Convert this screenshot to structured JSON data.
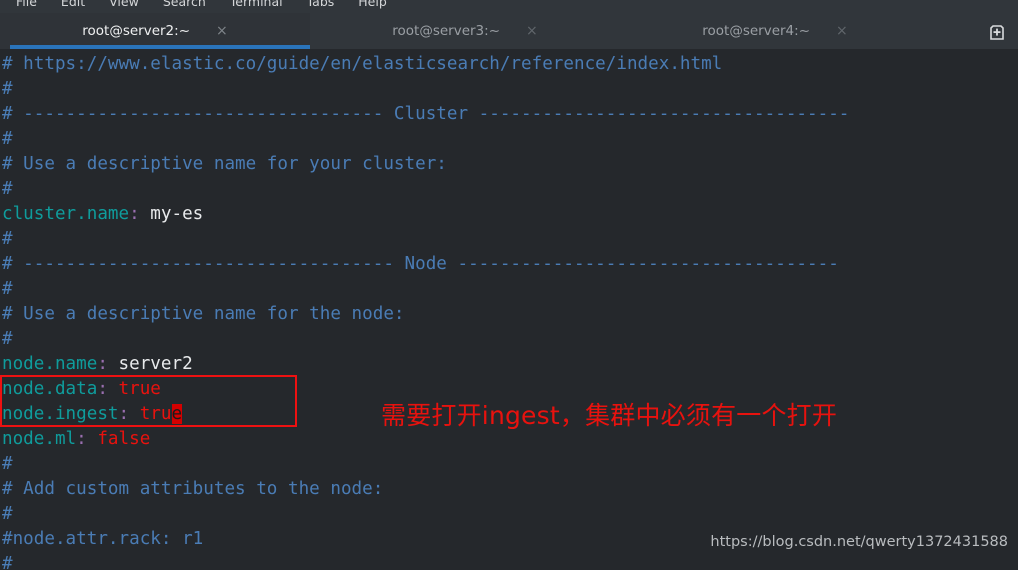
{
  "window": {
    "menu": [
      "File",
      "Edit",
      "View",
      "Search",
      "Terminal",
      "Tabs",
      "Help"
    ]
  },
  "tabs": {
    "items": [
      {
        "label": "root@server2:~",
        "close": "×",
        "active": true
      },
      {
        "label": "root@server3:~",
        "close": "×",
        "active": false
      },
      {
        "label": "root@server4:~",
        "close": "×",
        "active": false
      }
    ],
    "new_tab_label": "new-tab"
  },
  "terminal": {
    "lines": [
      {
        "type": "comment",
        "text": "# https://www.elastic.co/guide/en/elasticsearch/reference/index.html"
      },
      {
        "type": "comment",
        "text": "#"
      },
      {
        "type": "comment",
        "text": "# ---------------------------------- Cluster -----------------------------------"
      },
      {
        "type": "comment",
        "text": "#"
      },
      {
        "type": "comment",
        "text": "# Use a descriptive name for your cluster:"
      },
      {
        "type": "comment",
        "text": "#"
      },
      {
        "type": "setting",
        "key": "cluster.name",
        "colon": ":",
        "value": " my-es",
        "value_kind": "string"
      },
      {
        "type": "comment",
        "text": "#"
      },
      {
        "type": "comment",
        "text": "# ----------------------------------- Node ------------------------------------"
      },
      {
        "type": "comment",
        "text": "#"
      },
      {
        "type": "comment",
        "text": "# Use a descriptive name for the node:"
      },
      {
        "type": "comment",
        "text": "#"
      },
      {
        "type": "setting",
        "key": "node.name",
        "colon": ":",
        "value": " server2",
        "value_kind": "string"
      },
      {
        "type": "setting",
        "key": "node.data",
        "colon": ":",
        "value": " true",
        "value_kind": "bool"
      },
      {
        "type": "setting",
        "key": "node.ingest",
        "colon": ":",
        "value": " tru",
        "value_kind": "bool",
        "cursor_char": "e"
      },
      {
        "type": "setting",
        "key": "node.ml",
        "colon": ":",
        "value": " false",
        "value_kind": "bool"
      },
      {
        "type": "comment",
        "text": "#"
      },
      {
        "type": "comment",
        "text": "# Add custom attributes to the node:"
      },
      {
        "type": "comment",
        "text": "#"
      },
      {
        "type": "comment",
        "text": "#node.attr.rack: r1"
      },
      {
        "type": "comment",
        "text": "#"
      }
    ]
  },
  "annotations": {
    "note_text": "需要打开ingest，集群中必须有一个打开",
    "note_color": "#e8120e",
    "box_color": "#ee1111"
  },
  "watermark": {
    "text": "https://blog.csdn.net/qwerty1372431588"
  },
  "colors": {
    "terminal_bg": "#25282c",
    "chrome_bg": "#31363b",
    "comment": "#4a7cb5",
    "key": "#0f9c9c",
    "colon": "#9a6fb0",
    "value": "#e8eaec",
    "bool": "#e8120e",
    "active_tab_underline": "#2a74bb"
  }
}
